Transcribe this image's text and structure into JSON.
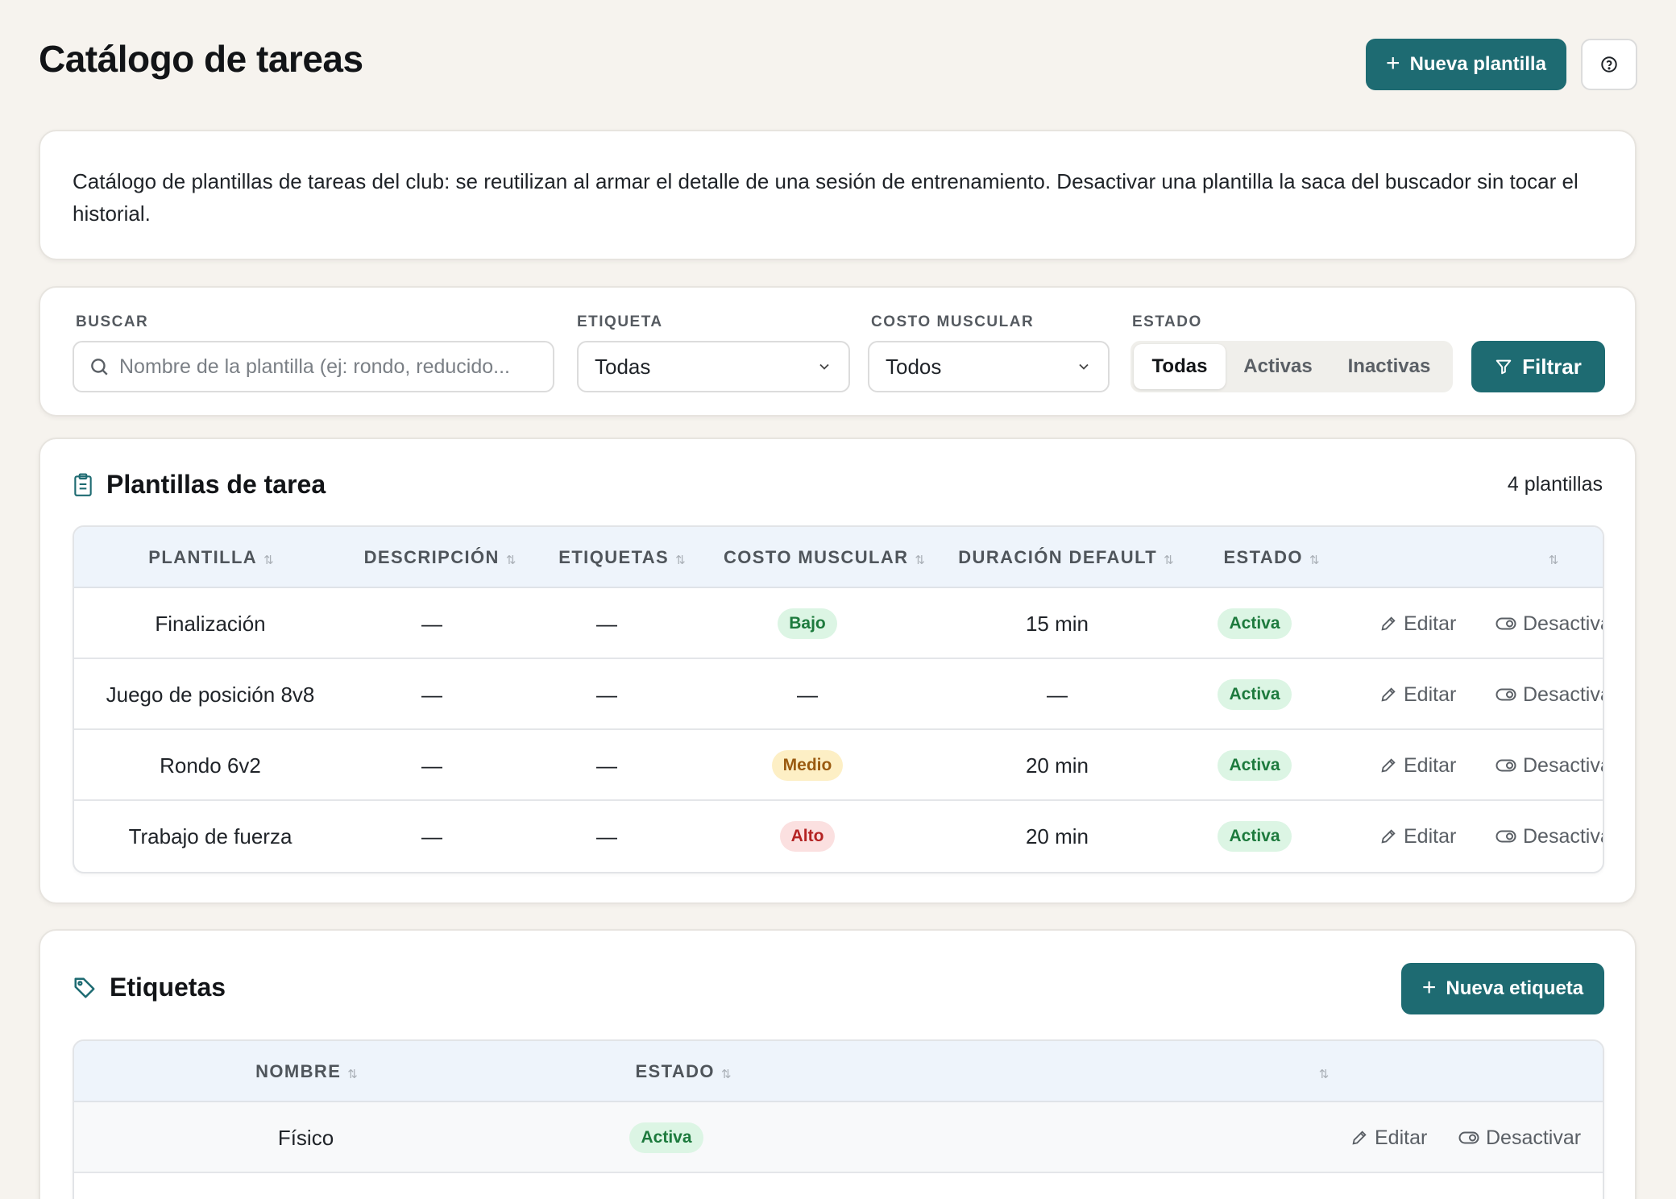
{
  "header": {
    "title": "Catálogo de tareas",
    "new_template_label": "Nueva plantilla",
    "help_icon": "help-circle-icon"
  },
  "info": {
    "text": "Catálogo de plantillas de tareas del club: se reutilizan al armar el detalle de una sesión de entrenamiento. Desactivar una plantilla la saca del buscador sin tocar el historial."
  },
  "filters": {
    "search_label": "BUSCAR",
    "search_placeholder": "Nombre de la plantilla (ej: rondo, reducido...",
    "tag_label": "ETIQUETA",
    "tag_value": "Todas",
    "cost_label": "COSTO MUSCULAR",
    "cost_value": "Todos",
    "status_label": "ESTADO",
    "status_options": [
      "Todas",
      "Activas",
      "Inactivas"
    ],
    "status_selected": "Todas",
    "filter_button": "Filtrar"
  },
  "templates": {
    "title": "Plantillas de tarea",
    "count": "4 plantillas",
    "columns": [
      "PLANTILLA",
      "DESCRIPCIÓN",
      "ETIQUETAS",
      "COSTO MUSCULAR",
      "DURACIÓN DEFAULT",
      "ESTADO"
    ],
    "rows": [
      {
        "name": "Finalización",
        "description": "—",
        "tags": "—",
        "cost": "Bajo",
        "duration": "15 min",
        "status": "Activa",
        "edit": "Editar",
        "deactivate": "Desactivar"
      },
      {
        "name": "Juego de posición 8v8",
        "description": "—",
        "tags": "—",
        "cost": "—",
        "duration": "—",
        "status": "Activa",
        "edit": "Editar",
        "deactivate": "Desactivar"
      },
      {
        "name": "Rondo 6v2",
        "description": "—",
        "tags": "—",
        "cost": "Medio",
        "duration": "20 min",
        "status": "Activa",
        "edit": "Editar",
        "deactivate": "Desactivar"
      },
      {
        "name": "Trabajo de fuerza",
        "description": "—",
        "tags": "—",
        "cost": "Alto",
        "duration": "20 min",
        "status": "Activa",
        "edit": "Editar",
        "deactivate": "Desactivar"
      }
    ]
  },
  "tags": {
    "title": "Etiquetas",
    "new_tag_label": "Nueva etiqueta",
    "columns": [
      "NOMBRE",
      "ESTADO"
    ],
    "rows": [
      {
        "name": "Físico",
        "status": "Activa",
        "edit": "Editar",
        "deactivate": "Desactivar"
      }
    ]
  },
  "colors": {
    "accent": "#1e6b72",
    "background": "#f6f3ee",
    "status_active": "#1d7a3d",
    "cost_low": "#1d7a3d",
    "cost_medium": "#9a5a10",
    "cost_high": "#b42323"
  }
}
